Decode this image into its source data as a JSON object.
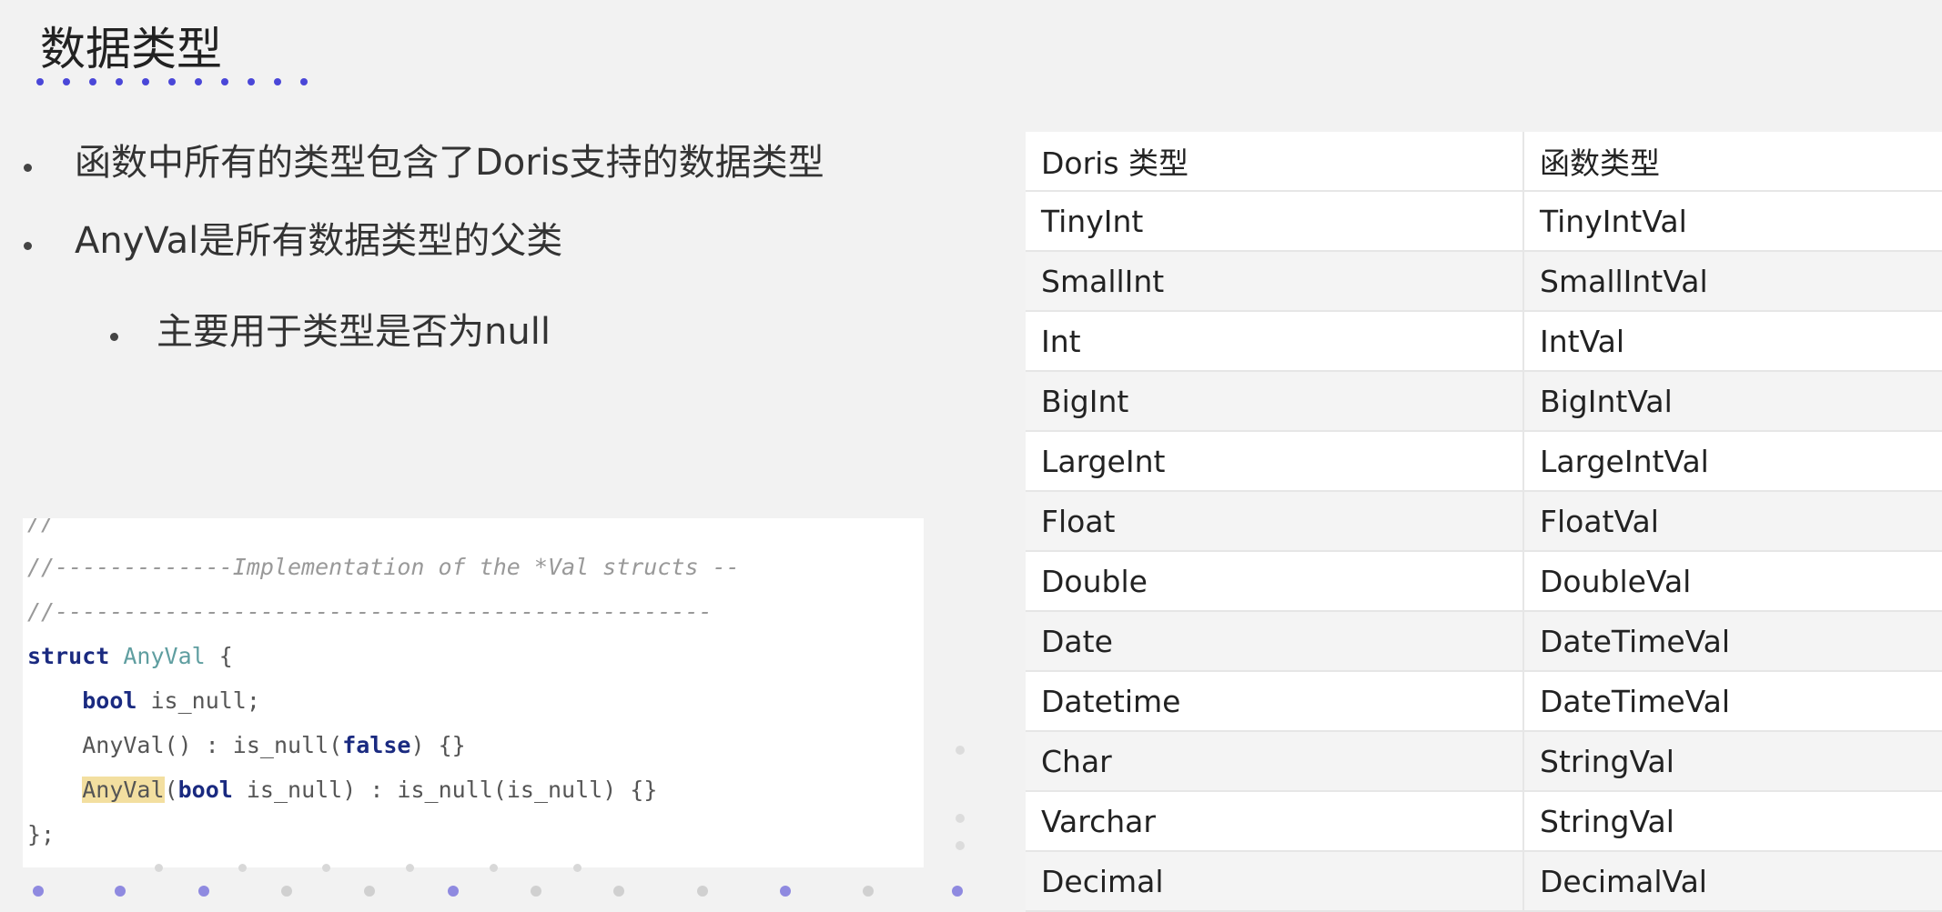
{
  "slide": {
    "title": "数据类型"
  },
  "bullets": [
    "函数中所有的类型包含了Doris支持的数据类型",
    "AnyVal是所有数据类型的父类",
    "主要用于类型是否为null"
  ],
  "code": {
    "line0": "//",
    "comment1": "//-------------Implementation of the *Val structs --",
    "comment2": "//------------------------------------------------",
    "kw_struct": "struct",
    "type_anyval": "AnyVal",
    "brace_open": " {",
    "kw_bool": "bool",
    "field_is_null": " is_null;",
    "ctor1_name": "AnyVal",
    "ctor1_open": "() : is_null(",
    "kw_false": "false",
    "ctor1_close": ") {}",
    "ctor2_name": "AnyVal",
    "ctor2_paren": "(",
    "kw_bool2": "bool",
    "ctor2_rest": " is_null) : is_null(is_null) {}",
    "brace_close": "};"
  },
  "table": {
    "headers": [
      "Doris 类型",
      "函数类型"
    ],
    "rows": [
      [
        "TinyInt",
        "TinyIntVal"
      ],
      [
        "SmallInt",
        "SmallIntVal"
      ],
      [
        "Int",
        "IntVal"
      ],
      [
        "BigInt",
        "BigIntVal"
      ],
      [
        "LargeInt",
        "LargeIntVal"
      ],
      [
        "Float",
        "FloatVal"
      ],
      [
        "Double",
        "DoubleVal"
      ],
      [
        "Date",
        "DateTimeVal"
      ],
      [
        "Datetime",
        "DateTimeVal"
      ],
      [
        "Char",
        "StringVal"
      ],
      [
        "Varchar",
        "StringVal"
      ],
      [
        "Decimal",
        "DecimalVal"
      ]
    ]
  },
  "colors": {
    "accent_dots": "#4a47d8",
    "code_keyword": "#1a2a80",
    "code_type": "#5f9ea0",
    "code_highlight": "#f3dfa0"
  }
}
